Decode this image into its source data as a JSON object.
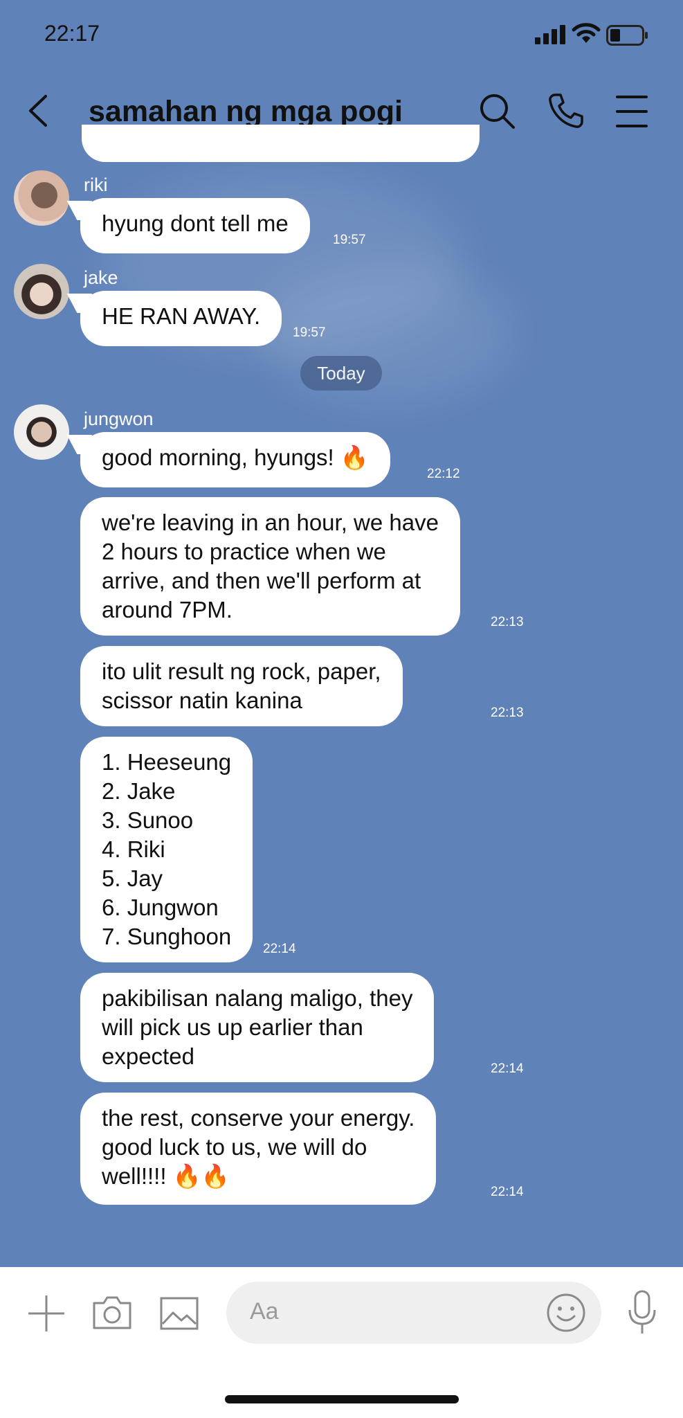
{
  "status_bar": {
    "time": "22:17",
    "icons": [
      "signal-icon",
      "wifi-icon",
      "battery-icon"
    ]
  },
  "header": {
    "title": "samahan ng mga pogi",
    "icons": [
      "back-icon",
      "search-icon",
      "call-icon",
      "menu-icon"
    ]
  },
  "colors": {
    "background": "#5f82b8",
    "bubble": "#ffffff",
    "date_pill": "#4b6491"
  },
  "messages": [
    {
      "sender": "riki",
      "text": "hyung dont tell me",
      "time": "19:57"
    },
    {
      "sender": "jake",
      "text": "HE RAN AWAY.",
      "time": "19:57"
    },
    {
      "sender": "jungwon",
      "text": "good morning, hyungs! 🔥",
      "time": "22:12"
    },
    {
      "text": "we're leaving in an hour, we have\n2 hours to practice when we\narrive, and then we'll perform at\naround 7PM.",
      "time": "22:13"
    },
    {
      "text": "ito ulit result ng rock, paper,\nscissor natin kanina",
      "time": "22:13"
    },
    {
      "text": "1. Heeseung\n2. Jake\n3. Sunoo\n4. Riki\n5. Jay\n6. Jungwon\n7. Sunghoon",
      "time": "22:14"
    },
    {
      "text": "pakibilisan nalang maligo, they\nwill pick us up earlier than\nexpected",
      "time": "22:14"
    },
    {
      "text": "the rest, conserve your energy.\ngood luck to us, we will do\nwell!!!! 🔥🔥",
      "time": "22:14"
    }
  ],
  "date_divider": "Today",
  "input": {
    "placeholder": "Aa",
    "icons": [
      "plus-icon",
      "camera-icon",
      "image-icon",
      "emoji-icon",
      "microphone-icon"
    ]
  }
}
